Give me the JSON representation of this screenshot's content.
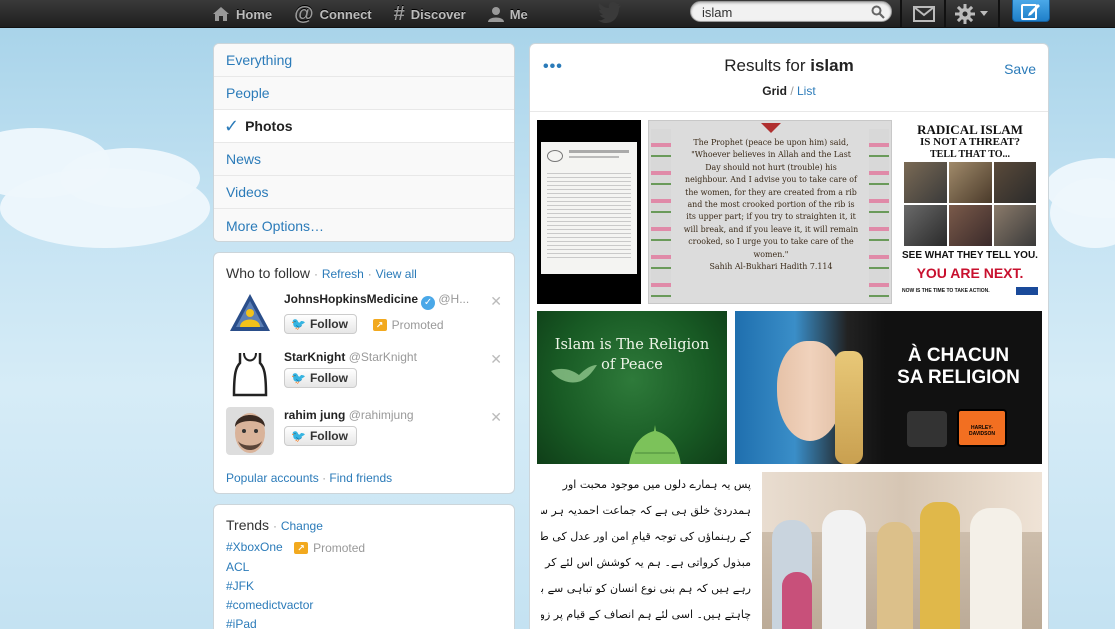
{
  "topbar": {
    "nav": [
      {
        "icon": "home-icon",
        "label": "Home"
      },
      {
        "icon": "at-icon",
        "label": "Connect"
      },
      {
        "icon": "hash-icon",
        "label": "Discover"
      },
      {
        "icon": "person-icon",
        "label": "Me"
      }
    ],
    "search_value": "islam"
  },
  "search_filters": {
    "items": [
      "Everything",
      "People",
      "Photos",
      "News",
      "Videos",
      "More Options…"
    ],
    "active": "Photos"
  },
  "who_to_follow": {
    "title": "Who to follow",
    "sep1": "·",
    "refresh": "Refresh",
    "sep2": "·",
    "view_all": "View all",
    "accounts": [
      {
        "name": "JohnsHopkinsMedicine",
        "handle": "@H...",
        "follow": "Follow",
        "promoted": "Promoted"
      },
      {
        "name": "StarKnight",
        "handle": "@StarKnight",
        "follow": "Follow"
      },
      {
        "name": "rahim jung",
        "handle": "@rahimjung",
        "follow": "Follow"
      }
    ],
    "popular_accounts": "Popular accounts",
    "sep3": "·",
    "find_friends": "Find friends"
  },
  "trends": {
    "title": "Trends",
    "sep": "·",
    "change": "Change",
    "items": [
      "#XboxOne",
      "ACL",
      "#JFK",
      "#comedictvactor",
      "#iPad"
    ],
    "promoted": "Promoted"
  },
  "results": {
    "title_prefix": "Results for",
    "query": "islam",
    "view_grid": "Grid",
    "view_sep": "/",
    "view_list": "List",
    "save": "Save"
  },
  "photo_texts": {
    "hadith": [
      "The Prophet (peace be upon him) said,",
      "\"Whoever believes in Allah and the Last",
      "Day should not hurt (trouble) his",
      "neighbour. And I advise you to take care of",
      "the women, for they are created from a rib",
      "and the most crooked portion of the rib is",
      "its upper part; if you try to straighten it, it",
      "will break, and if you leave it, it will remain",
      "crooked, so I urge you to take care of the",
      "women.\"",
      "Sahih Al-Bukhari Hadith 7.114"
    ],
    "radical_line1": "RADICAL ISLAM",
    "radical_line2": "IS NOT A THREAT?",
    "radical_line3": "TELL THAT TO...",
    "radical_line4": "SEE WHAT THEY TELL YOU.",
    "radical_line5": "YOU ARE NEXT.",
    "radical_line6": "NOW IS THE TIME TO TAKE ACTION.",
    "peace_line1": "Islam is The Religion",
    "peace_line2": "of Peace",
    "chacun_line1": "À CHACUN",
    "chacun_line2": "SA RELIGION",
    "brand1": "HARLEY-DAVIDSON",
    "urdu_lines": [
      "پس یہ ہمارے دلوں میں موجود محبت اور",
      "ہمدردیٔ خلق ہی ہے کہ جماعت احمدیہ ہر سطح پر دنیا",
      "کے رہنماؤں کی توجہ قیامِ امن اور عدل کی طرف",
      "مبذول کرواتی ہے۔ ہم یہ کوشش اس لئے کر",
      "رہے ہیں کہ ہم بنی نوع انسان کو تباہی سے بچانا",
      "چاہتے ہیں۔ اسی لئے ہم انصاف کے قیام پر زور"
    ]
  },
  "colors": {
    "link": "#2b7bb9",
    "topbar": "#2a2a2a",
    "background": "#c0deed",
    "promoted": "#f2a91e"
  }
}
